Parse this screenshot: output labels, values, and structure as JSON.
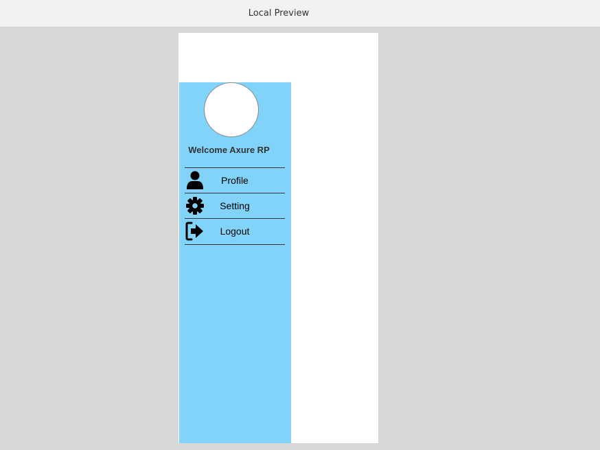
{
  "window": {
    "title": "Local Preview"
  },
  "sidebar": {
    "welcome_text": "Welcome Axure RP",
    "items": [
      {
        "label": "Profile",
        "icon": "user-icon"
      },
      {
        "label": "Setting",
        "icon": "gear-icon"
      },
      {
        "label": "Logout",
        "icon": "logout-icon"
      }
    ]
  },
  "colors": {
    "sidebar_bg": "#81d3f9",
    "canvas_bg": "#ffffff",
    "workspace_bg": "#d7d7d7"
  }
}
